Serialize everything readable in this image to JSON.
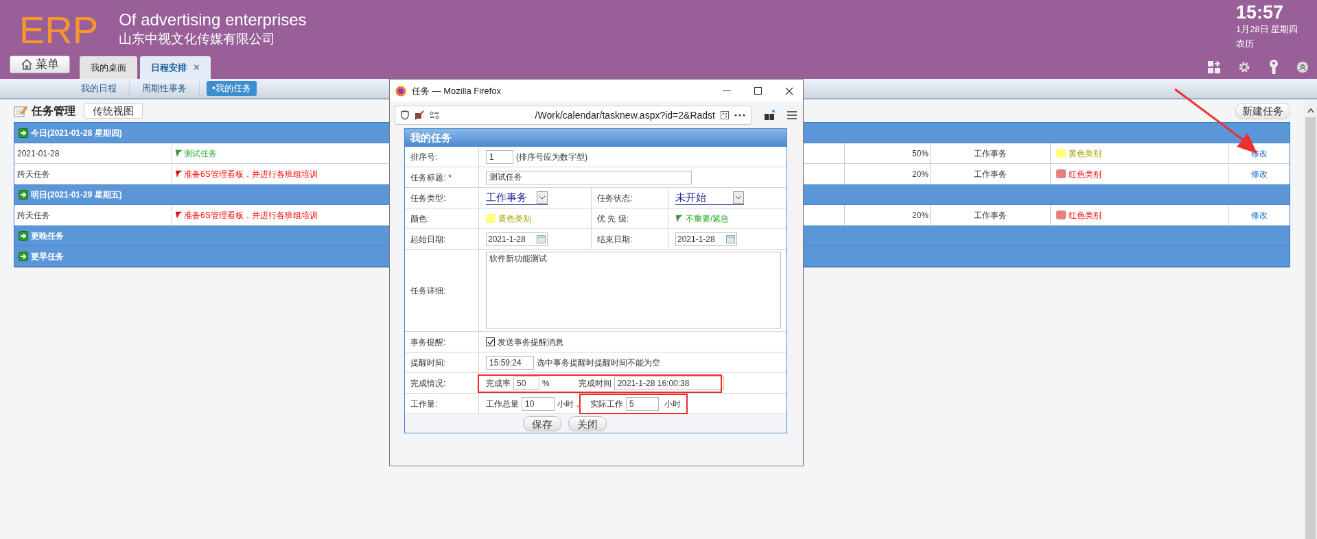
{
  "header": {
    "logo": "ERP",
    "title": "Of advertising enterprises",
    "company": "山东中视文化传媒有限公司",
    "clock": {
      "time": "15:57",
      "date": "1月28日 星期四",
      "lunar": "农历"
    }
  },
  "menu_button": "菜单",
  "tabs": [
    {
      "label": "我的桌面",
      "selected": false
    },
    {
      "label": "日程安排",
      "selected": true,
      "close": "×"
    }
  ],
  "subnav": [
    {
      "label": "我的日程",
      "selected": false
    },
    {
      "label": "周期性事务",
      "selected": false
    },
    {
      "label": "•我的任务",
      "selected": true
    }
  ],
  "page": {
    "title": "任务管理",
    "view_button": "传统视图",
    "new_button": "新建任务"
  },
  "task_groups": [
    {
      "title": "今日(2021-01-28 星期四)",
      "tasks": [
        {
          "date": "2021-01-28",
          "title": "测试任务",
          "color": "#22aa22",
          "percent": "50%",
          "type": "工作事务",
          "category": {
            "label": "黄色类别",
            "color": "#ffff80"
          },
          "action": "修改"
        },
        {
          "date": "跨天任务",
          "title": "准备6S管理看板，并进行各班组培训",
          "color": "#ff0000",
          "percent": "20%",
          "type": "工作事务",
          "category": {
            "label": "红色类别",
            "color": "#e88080"
          },
          "action": "修改"
        }
      ]
    },
    {
      "title": "明日(2021-01-29 星期五)",
      "tasks": [
        {
          "date": "跨天任务",
          "title": "准备6S管理看板，并进行各班组培训",
          "color": "#ff0000",
          "percent": "20%",
          "type": "工作事务",
          "category": {
            "label": "红色类别",
            "color": "#e88080"
          },
          "action": "修改"
        }
      ]
    },
    {
      "title": "更晚任务"
    },
    {
      "title": "更早任务"
    }
  ],
  "dialog": {
    "window_title": "任务 — Mozilla Firefox",
    "url": "/Work/calendar/tasknew.aspx?id=2&Radst",
    "form_title": "我的任务",
    "sort": {
      "label": "排序号:",
      "value": "1",
      "hint": "(排序号应为数字型)"
    },
    "title": {
      "label": "任务标题:",
      "required": "*",
      "value": "测试任务"
    },
    "type": {
      "label": "任务类型:",
      "value": "工作事务"
    },
    "status": {
      "label": "任务状态:",
      "value": "未开始"
    },
    "category": {
      "label": "颜色:",
      "value": "黄色类别",
      "color": "#ffff80"
    },
    "priority": {
      "label": "优 先 级:",
      "value": "不重要/紧急",
      "color": "#22aa22"
    },
    "start": {
      "label": "起始日期:",
      "value": "2021-1-28"
    },
    "end": {
      "label": "结束日期:",
      "value": "2021-1-28"
    },
    "detail": {
      "label": "任务详细:",
      "value": "软件新功能测试"
    },
    "reminder": {
      "label": "事务提醒:",
      "checkbox": "发送事务提醒消息",
      "checked": true
    },
    "remind_time": {
      "label": "提醒时间:",
      "value": "15:59:24",
      "hint": "选中事务提醒时提醒时间不能为空"
    },
    "completion": {
      "label": "完成情况:",
      "rate_label": "完成率",
      "rate": "50",
      "unit": "%",
      "time_label": "完成时间",
      "time": "2021-1-28 16:00:38"
    },
    "workload": {
      "label": "工作量:",
      "total_label": "工作总量",
      "total": "10",
      "total_unit": "小时，",
      "actual_label": "实际工作",
      "actual": "5",
      "actual_unit": "小时"
    },
    "buttons": [
      "保存",
      "关闭"
    ]
  }
}
